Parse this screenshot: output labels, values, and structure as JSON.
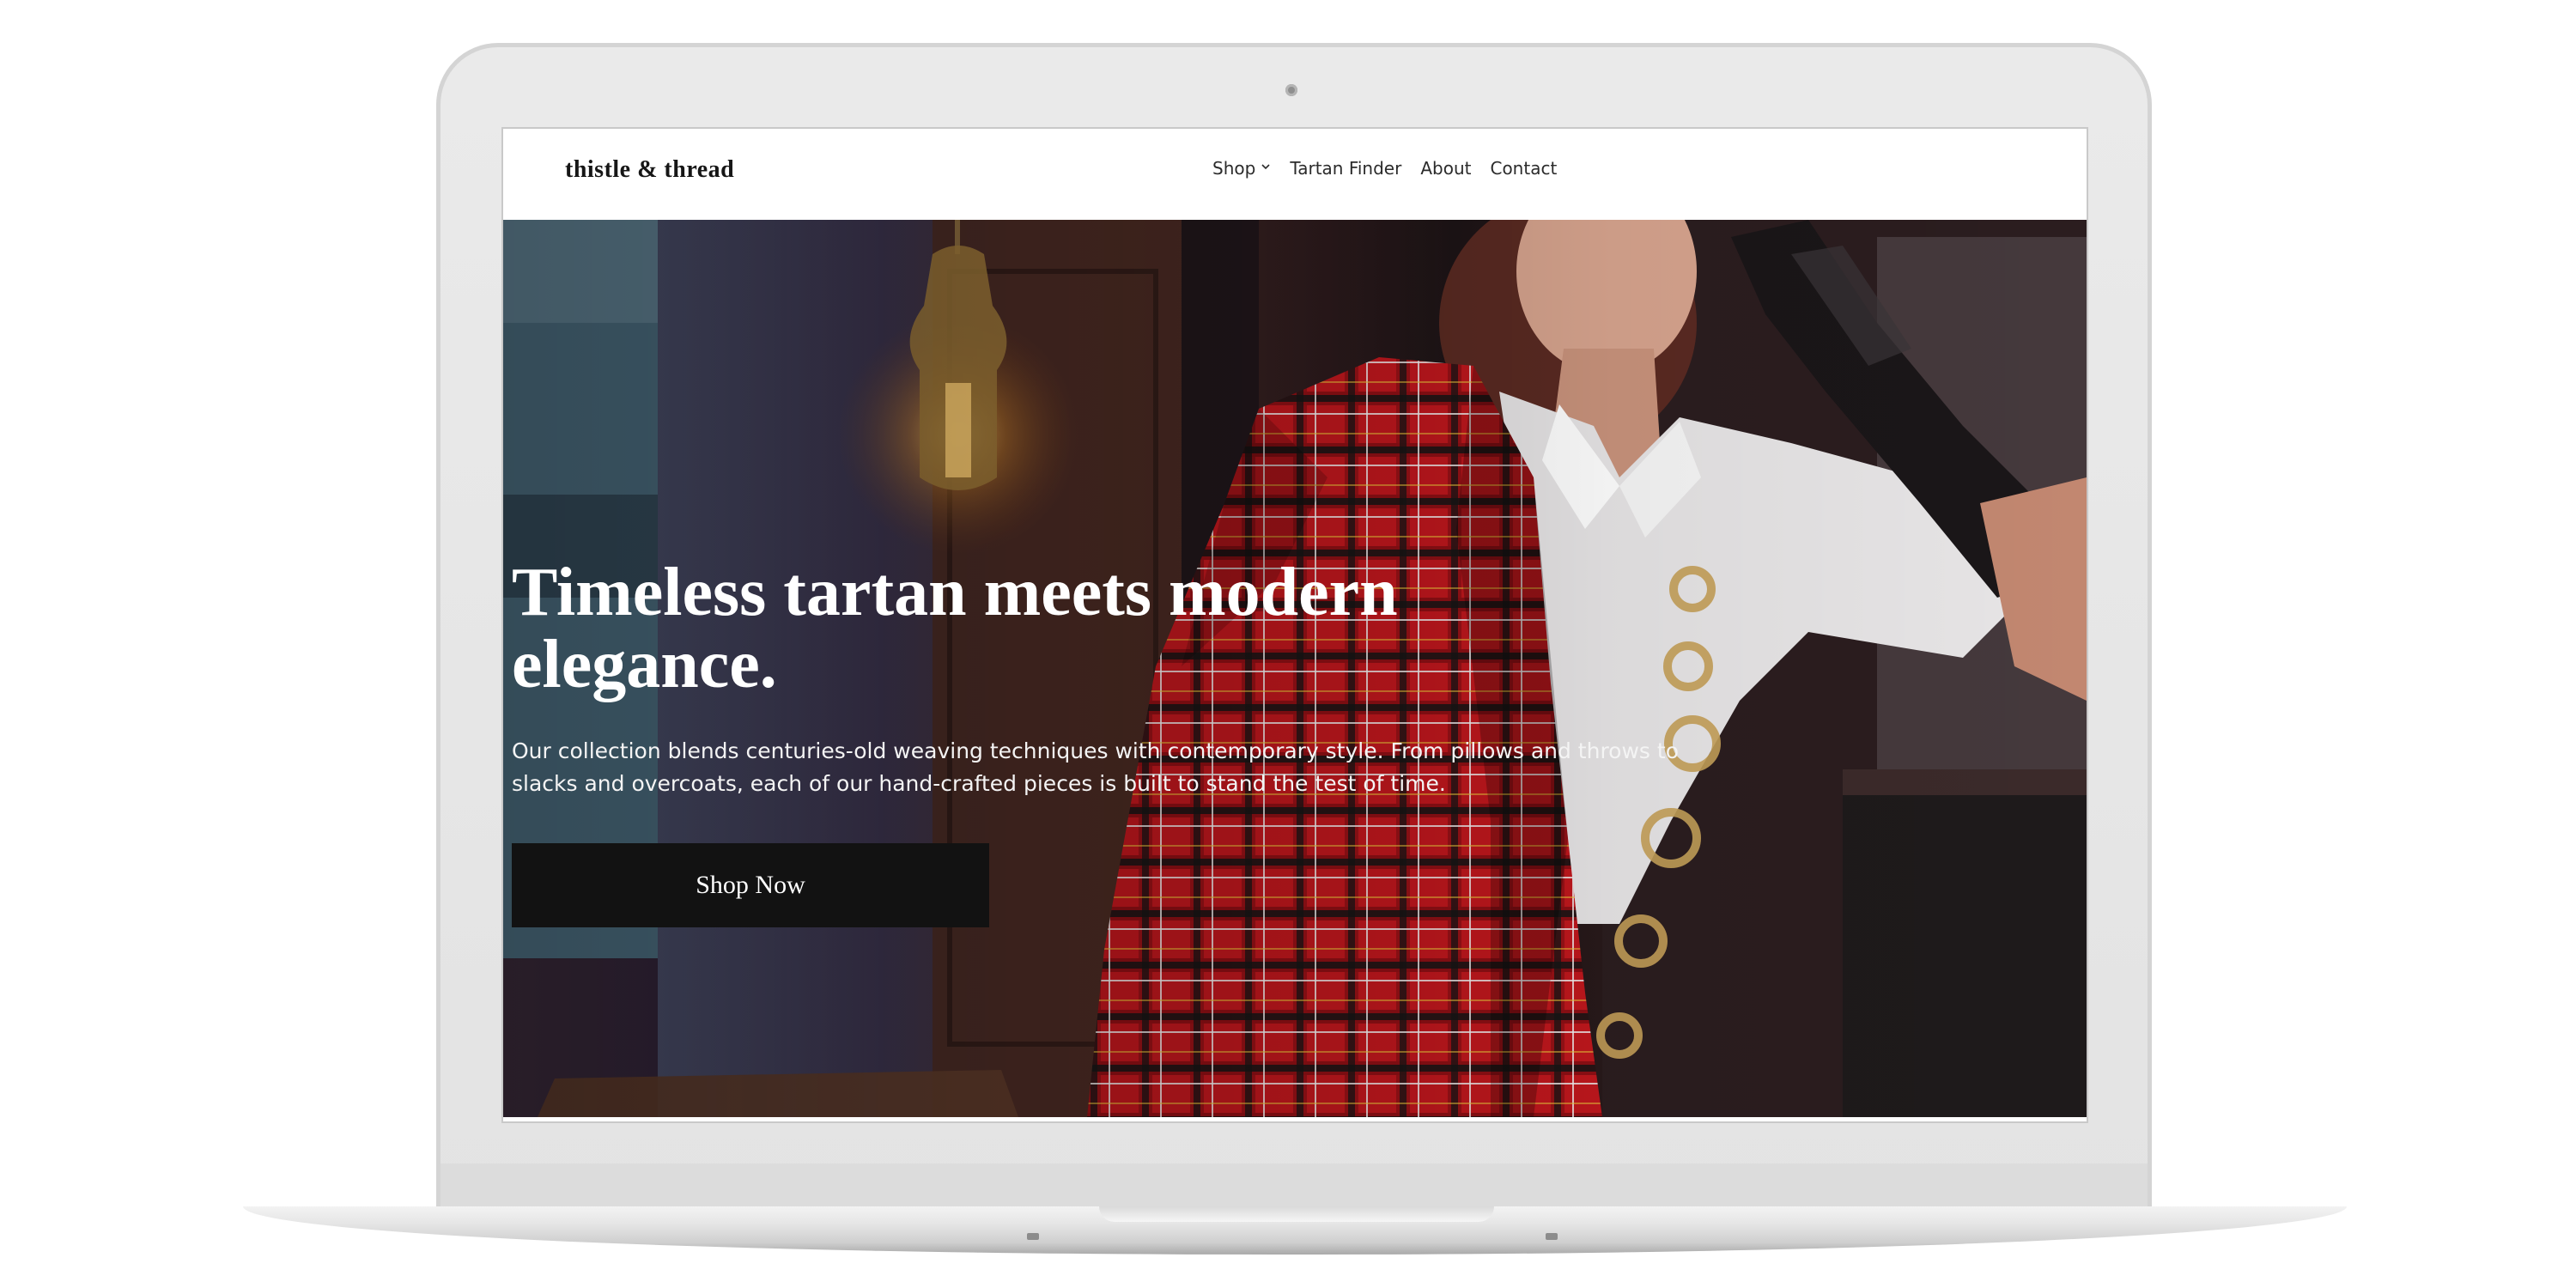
{
  "header": {
    "logo": "thistle & thread",
    "nav": {
      "shop": "Shop",
      "tartan_finder": "Tartan Finder",
      "about": "About",
      "contact": "Contact"
    }
  },
  "hero": {
    "title": "Timeless tartan meets modern elegance.",
    "description": "Our collection blends centuries-old weaving techniques with contemporary style. From pillows and throws to slacks and overcoats, each of our hand-crafted pieces is built to stand the test of time.",
    "cta_label": "Shop Now"
  },
  "icons": {
    "shop_dropdown": "chevron-down-icon",
    "camera": "camera-dot"
  },
  "colors": {
    "header_bg": "#ffffff",
    "button_bg": "#121212",
    "hero_text": "#ffffff",
    "tartan_red": "#c0171d"
  }
}
